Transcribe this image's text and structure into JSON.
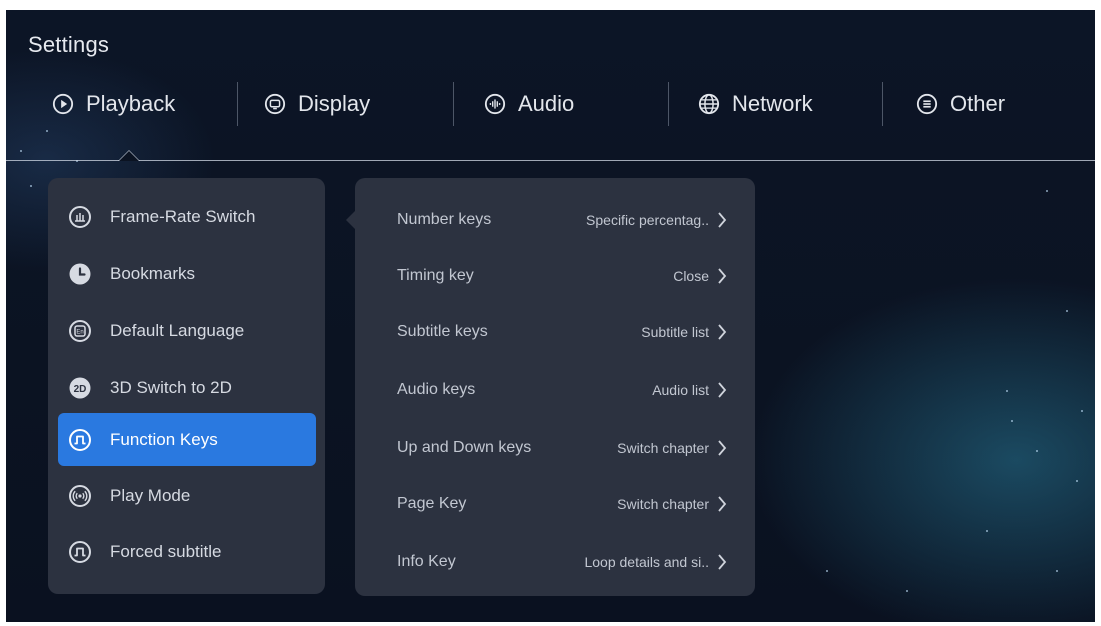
{
  "header": {
    "title": "Settings"
  },
  "tabs": [
    {
      "label": "Playback",
      "icon": "play-circle-icon"
    },
    {
      "label": "Display",
      "icon": "monitor-icon"
    },
    {
      "label": "Audio",
      "icon": "audio-waveform-icon"
    },
    {
      "label": "Network",
      "icon": "globe-icon"
    },
    {
      "label": "Other",
      "icon": "menu-circle-icon"
    }
  ],
  "active_tab": "Playback",
  "sidebar": {
    "items": [
      {
        "label": "Frame-Rate Switch",
        "icon": "frame-rate-icon"
      },
      {
        "label": "Bookmarks",
        "icon": "clock-icon"
      },
      {
        "label": "Default Language",
        "icon": "language-icon"
      },
      {
        "label": "3D Switch to 2D",
        "icon": "2d-icon"
      },
      {
        "label": "Function Keys",
        "icon": "function-key-icon"
      },
      {
        "label": "Play Mode",
        "icon": "broadcast-icon"
      },
      {
        "label": "Forced subtitle",
        "icon": "subtitle-pulse-icon"
      }
    ],
    "active_item": "Function Keys"
  },
  "settings": {
    "rows": [
      {
        "label": "Number keys",
        "value": "Specific percentag.."
      },
      {
        "label": "Timing key",
        "value": "Close"
      },
      {
        "label": "Subtitle keys",
        "value": "Subtitle list"
      },
      {
        "label": "Audio keys",
        "value": "Audio list"
      },
      {
        "label": "Up and Down keys",
        "value": "Switch chapter"
      },
      {
        "label": "Page Key",
        "value": "Switch chapter"
      },
      {
        "label": "Info Key",
        "value": "Loop details and si.."
      }
    ]
  },
  "colors": {
    "accent": "#2a79e0",
    "panel": "#2c3240",
    "background": "#0b1322"
  }
}
